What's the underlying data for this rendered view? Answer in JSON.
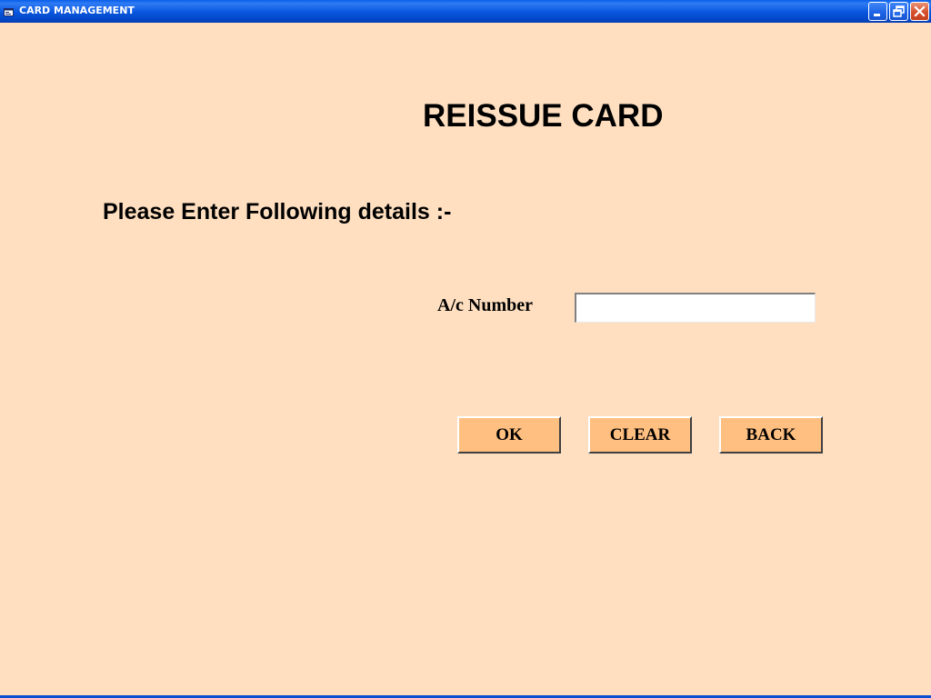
{
  "window": {
    "title": "CARD MANAGEMENT",
    "icons": {
      "app": "app-icon",
      "minimize": "minimize-icon",
      "maximize": "restore-icon",
      "close": "close-icon"
    }
  },
  "form": {
    "heading": "REISSUE CARD",
    "instructions": "Please Enter Following details :-",
    "account": {
      "label": "A/c Number",
      "value": "",
      "placeholder": ""
    },
    "buttons": {
      "ok": "OK",
      "clear": "CLEAR",
      "back": "BACK"
    }
  },
  "colors": {
    "background": "#FFDFC0",
    "button": "#FFBF80",
    "titlebar": "#0855DD"
  }
}
